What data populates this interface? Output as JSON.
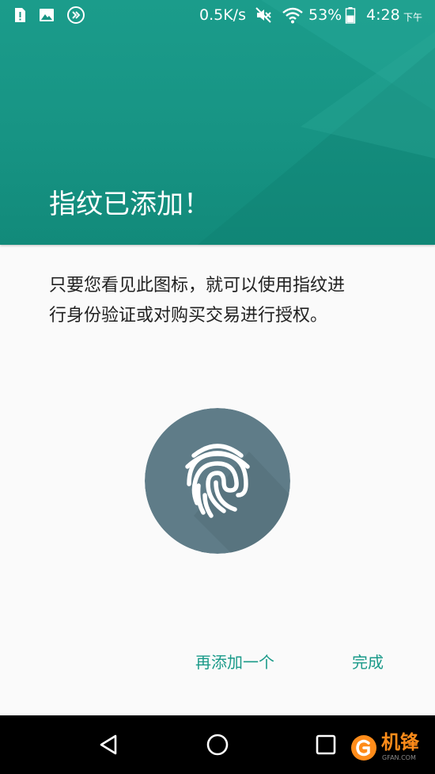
{
  "statusbar": {
    "notification_icons": [
      "sim-alert-icon",
      "image-icon",
      "fast-forward-circle-icon"
    ],
    "network_speed": "0.5K/s",
    "mute_icon": "volume-off-icon",
    "wifi_icon": "wifi-icon",
    "battery_percent": "53%",
    "battery_level": 0.53,
    "time": "4:28",
    "ampm": "下午"
  },
  "header": {
    "title": "指纹已添加！",
    "color": "#179484"
  },
  "description": {
    "line1": "只要您看见此图标，就可以使用指纹进",
    "line2": "行身份验证或对购买交易进行授权。"
  },
  "fingerprint": {
    "icon": "fingerprint-icon",
    "circle_color": "#607d8b"
  },
  "actions": {
    "add_another": "再添加一个",
    "done": "完成",
    "color": "#1a9a89"
  },
  "navbar": {
    "back_icon": "back-triangle-icon",
    "home_icon": "home-circle-icon",
    "recents_icon": "recents-square-icon"
  },
  "watermark": {
    "brand": "机锋",
    "domain": "GFAN.COM"
  }
}
